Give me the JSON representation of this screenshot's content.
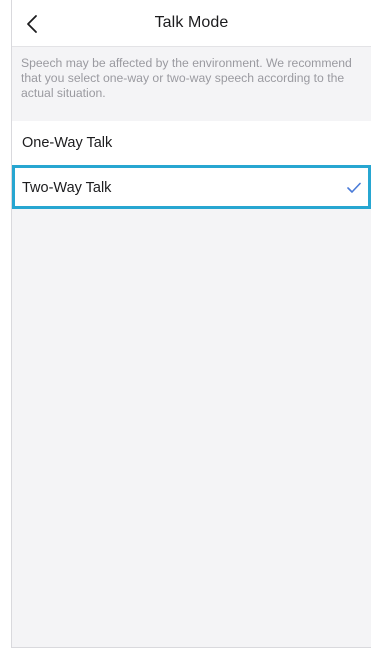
{
  "header": {
    "title": "Talk Mode",
    "back_icon": "chevron-left-icon"
  },
  "notice": {
    "text": "Speech may be affected by the environment. We recommend that you select one-way or two-way speech according to the actual situation."
  },
  "options": [
    {
      "label": "One-Way Talk",
      "selected": false
    },
    {
      "label": "Two-Way Talk",
      "selected": true
    }
  ],
  "colors": {
    "check": "#4a7bd8",
    "selection_outline": "#27a6d1",
    "background": "#f4f4f6"
  }
}
